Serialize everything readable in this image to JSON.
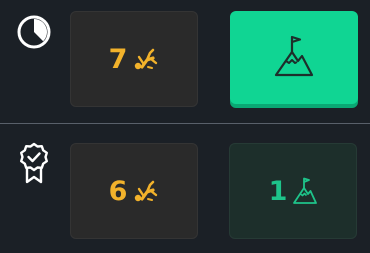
{
  "rows": [
    {
      "icon": "timer-icon",
      "stat_value": "7",
      "stat_icon": "falling-person-icon",
      "goal_icon": "mountain-flag-icon",
      "goal_state": "active"
    },
    {
      "icon": "award-ribbon-icon",
      "stat_value": "6",
      "stat_icon": "falling-person-icon",
      "goal_value": "1",
      "goal_icon": "mountain-flag-icon",
      "goal_state": "count"
    }
  ],
  "colors": {
    "background": "#1b2026",
    "stat_accent": "#f2b22b",
    "goal_active": "#10d593",
    "goal_text": "#1ec48a"
  }
}
